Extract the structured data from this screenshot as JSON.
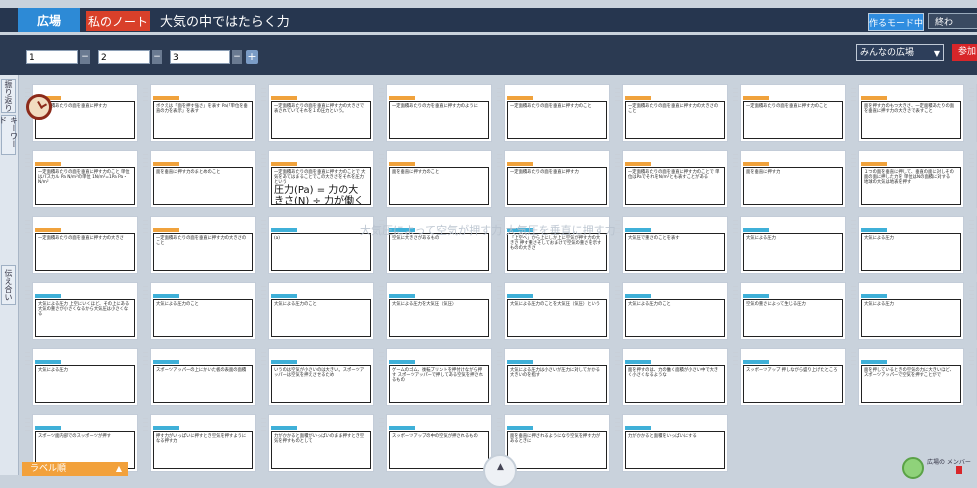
{
  "header": {
    "tab_plaza": "広場",
    "tab_note": "私のノート",
    "title": "大気の中ではたらく力",
    "mode_button": "作るモード中",
    "end_button": "終わ"
  },
  "toolbar": {
    "col1": "1",
    "col2": "2",
    "col3": "3",
    "add": "+",
    "minus": "−",
    "select_value": "みんなの広場",
    "join_button": "参加"
  },
  "sidebar": {
    "tab1": "振り返り",
    "tab2": "キーワード",
    "tab3": "伝え合い"
  },
  "cards": [
    {
      "text": "一定面積あたりの面を垂直に押す力",
      "label": "orange",
      "border": "orange"
    },
    {
      "text": "ボクえは「面を押す強さ」を表す Pa(「単位を垂直の力を表示」を表す",
      "label": "orange",
      "border": "orange"
    },
    {
      "text": "一定面積あたりの面を垂直に押す力の大きさで表されていてそれを１の圧力という。",
      "label": "orange",
      "border": "orange"
    },
    {
      "text": "一定面積あたりの力を垂直に押す力のように",
      "label": "orange",
      "border": "orange"
    },
    {
      "text": "一定面積あたりの面を垂直に押す力のこと",
      "label": "orange",
      "border": "orange"
    },
    {
      "text": "一定面積あたりの面を垂直に押す力の大きさのこと",
      "label": "orange",
      "border": "orange"
    },
    {
      "text": "一定面積あたりの面を垂直に押す力のこと",
      "label": "orange",
      "border": "orange"
    },
    {
      "text": "面を押す力のもつ大きさ、一定面積あたりの面を垂直に押す力の大きさで表すこと",
      "label": "orange",
      "border": "orange"
    },
    {
      "text": "一定面積あたりの面を垂直に押す力の大きさのことを圧力という",
      "label": "orange",
      "border": "orange"
    },
    {
      "text": "一定面積あたりの面を垂直に押す力のこと 単位はパスカル Pa N/m²の単位 1N/m²=1Pa Pa・N/m²",
      "label": "orange",
      "border": "orange"
    },
    {
      "text": "面を垂直に押す力のまとめのこと",
      "label": "orange",
      "border": "orange"
    },
    {
      "text": "一定面積あたりの面を垂直に押す力のことで 大気をあてはまることでこの大きさをそれを圧力という",
      "label": "orange",
      "border": "orange",
      "formula": "圧力(Pa) = 力の大きさ(N) ÷ 力が働く面積(m²)"
    },
    {
      "text": "面を垂直に押す力のこと",
      "label": "orange",
      "border": "orange"
    },
    {
      "text": "一定面積あたりの面を垂直に押す力",
      "label": "orange",
      "border": "orange"
    },
    {
      "text": "一定面積あたりの面を垂直に押す力のことで 単位はPaでそれをN/m²とも表すことがある",
      "label": "orange",
      "border": "orange"
    },
    {
      "text": "面を垂直に押す力",
      "label": "orange",
      "border": "orange"
    },
    {
      "text": "１つの面を垂直に押して、垂直の面に対しその面の面に押した力を 単位はNの面積に対する",
      "label": "orange",
      "border": "orange",
      "extra": "地球の大気は地表を押す"
    },
    {
      "text": "ｎつの面を垂直に押して、垂直の面に対しその面の面に押したもの",
      "label": "orange",
      "border": "orange"
    },
    {
      "text": "一定面積あたりの面を垂直に押す力の大きさ",
      "label": "orange",
      "border": "orange"
    },
    {
      "text": "一定面積あたりの面を垂直に押す力の大きさのこと",
      "label": "orange",
      "border": "orange"
    },
    {
      "text": "(a)",
      "label": "blue",
      "border": "cyan"
    },
    {
      "text": "空気に大きさがあるもの",
      "label": "blue",
      "border": "cyan"
    },
    {
      "text": "「上空へ」から上にしか上に空気が押す力の大きさ 押す重さそしておまけで空気の重さを示すものの大きさ",
      "label": "blue",
      "border": "cyan"
    },
    {
      "text": "大気圧で重さのことを表す",
      "label": "blue",
      "border": "cyan"
    },
    {
      "text": "大気による圧力",
      "label": "blue",
      "border": "cyan"
    },
    {
      "text": "大気による圧力",
      "label": "blue",
      "border": "cyan"
    },
    {
      "text": "大気による圧力",
      "label": "blue",
      "border": "cyan"
    },
    {
      "text": "大気による圧力 上空にいくほど、その上にある大気の重さが小さくなるから大気圧は小さくなる",
      "label": "blue",
      "border": "cyan"
    },
    {
      "text": "大気による圧力のこと",
      "label": "blue",
      "border": "cyan"
    },
    {
      "text": "大気による圧力のこと",
      "label": "blue",
      "border": "cyan"
    },
    {
      "text": "大気による圧力を大気圧（気圧）",
      "label": "blue",
      "border": "cyan"
    },
    {
      "text": "大気による圧力のことを大気圧（気圧）という",
      "label": "blue",
      "border": "cyan"
    },
    {
      "text": "大気による圧力のこと",
      "label": "blue",
      "border": "cyan"
    },
    {
      "text": "空気の重さによって生じる圧力",
      "label": "blue",
      "border": "cyan"
    },
    {
      "text": "大気による圧力",
      "label": "blue",
      "border": "cyan"
    },
    {
      "text": "大気による圧力",
      "label": "blue",
      "border": "cyan"
    },
    {
      "text": "大気による圧力",
      "label": "blue",
      "border": "cyan"
    },
    {
      "text": "スポーツアッパーの上にかいた板の表面の面積",
      "label": "blue",
      "border": "cyan"
    },
    {
      "text": "いうのは空気が小さいのは大きい。スポーツアッパーは空気を押えさせるため",
      "label": "blue",
      "border": "cyan"
    },
    {
      "text": "ゲームのゴム、後転プリントを押付けながら押す スポーツアッパーで押してある空気を押されるもの",
      "label": "blue",
      "border": "cyan"
    },
    {
      "text": "大気による圧力は小さいが圧力に対してかかる大きいのを指す",
      "label": "blue",
      "border": "cyan"
    },
    {
      "text": "面を押すのは、力の働く面積が小さい中で大きく小さくなるような",
      "label": "blue",
      "border": "cyan"
    },
    {
      "text": "スッポーツアップ 押しながら盛り上げたところ",
      "label": "blue",
      "border": "cyan"
    },
    {
      "text": "面を押しているときの空気の力に大きいほど、スポーツアッパーで空気を押すことがで",
      "label": "blue",
      "border": "cyan"
    },
    {
      "text": "スッポーツの中に空気が押されて中のものを出す",
      "label": "blue",
      "border": "cyan",
      "handwrite": "スッポーポ　くつ"
    },
    {
      "text": "スポーツ面内部でのスッポーツが押す",
      "label": "blue",
      "border": "cyan"
    },
    {
      "text": "押す力がいっぱいに押すとき空気を押すようになる押す力",
      "label": "blue",
      "border": "cyan"
    },
    {
      "text": "力がかかると面積がいっぱいのまま押すとき空気を押すものとして",
      "label": "blue",
      "border": "cyan"
    },
    {
      "text": "スッポーツアップの中の空気が押されるもの",
      "label": "blue",
      "border": "cyan"
    },
    {
      "text": "面を垂直に押されるようになり空気を押す力があるときに",
      "label": "blue",
      "border": "cyan"
    },
    {
      "text": "力がかかると面積をいっぱいにする",
      "label": "blue",
      "border": "cyan"
    }
  ],
  "overlay_text": "大気圧によって空気が押す力 大気圧を垂直に押す力",
  "bottom": {
    "label_button": "ラベル順",
    "center_icon": "▲",
    "member_text": "広場の メンバー"
  }
}
